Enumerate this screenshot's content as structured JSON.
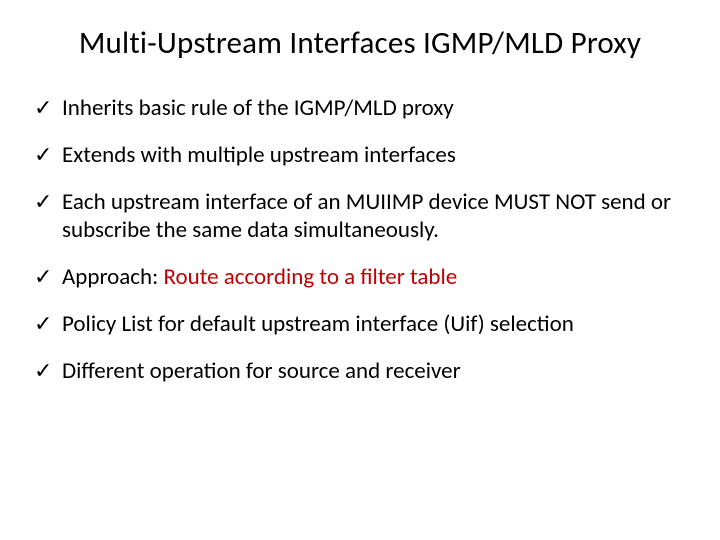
{
  "title": "Multi-Upstream Interfaces IGMP/MLD Proxy",
  "bullets": {
    "b0": "Inherits basic rule of the IGMP/MLD proxy",
    "b1": "Extends with multiple upstream interfaces",
    "b2": "Each upstream interface of an MUIIMP device MUST NOT send or subscribe the same data simultaneously.",
    "b3_prefix": "Approach: ",
    "b3_highlight": "Route according to a filter table",
    "b4": "Policy List for default upstream interface (Uif) selection",
    "b5": "Different operation for source and receiver"
  }
}
